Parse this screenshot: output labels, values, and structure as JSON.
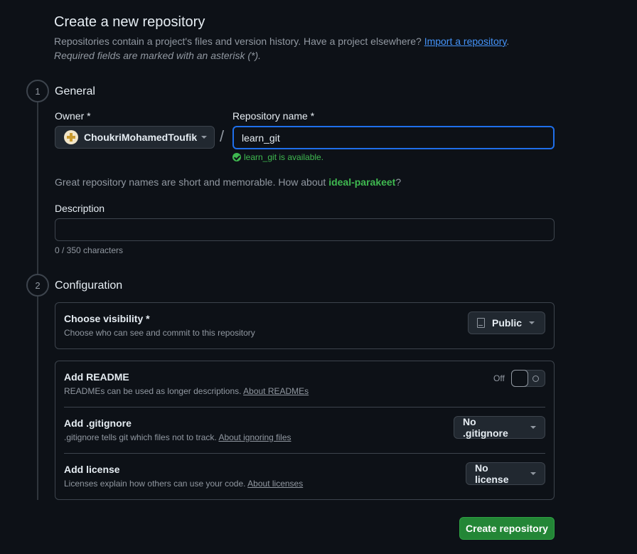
{
  "header": {
    "title": "Create a new repository",
    "subtitle": "Repositories contain a project's files and version history. Have a project elsewhere?",
    "import_link": "Import a repository",
    "subtitle_end": ".",
    "required_note": "Required fields are marked with an asterisk (*)."
  },
  "general": {
    "step": "1",
    "title": "General",
    "owner_label": "Owner *",
    "owner_value": "ChoukriMohamedToufik",
    "slash": "/",
    "repo_label": "Repository name *",
    "repo_value": "learn_git",
    "available_text": "learn_git is available.",
    "suggestion_prefix": "Great repository names are short and memorable. How about",
    "suggestion_name": "ideal-parakeet",
    "suggestion_suffix": "?",
    "description_label": "Description",
    "description_value": "",
    "char_count": "0 / 350 characters"
  },
  "configuration": {
    "step": "2",
    "title": "Configuration",
    "visibility": {
      "title": "Choose visibility *",
      "desc": "Choose who can see and commit to this repository",
      "value": "Public"
    },
    "readme": {
      "title": "Add README",
      "desc": "READMEs can be used as longer descriptions.",
      "link": "About READMEs",
      "toggle_label": "Off"
    },
    "gitignore": {
      "title": "Add .gitignore",
      "desc": ".gitignore tells git which files not to track.",
      "link": "About ignoring files",
      "value": "No .gitignore"
    },
    "license": {
      "title": "Add license",
      "desc": "Licenses explain how others can use your code.",
      "link": "About licenses",
      "value": "No license"
    }
  },
  "footer": {
    "create_label": "Create repository"
  },
  "colors": {
    "background": "#0d1117",
    "accent_blue": "#1f6feb",
    "success_green": "#3fb950",
    "primary_button": "#238636"
  },
  "icons": {
    "repo": "repo-icon",
    "check": "check-circle-icon",
    "caret": "triangle-down-icon"
  }
}
